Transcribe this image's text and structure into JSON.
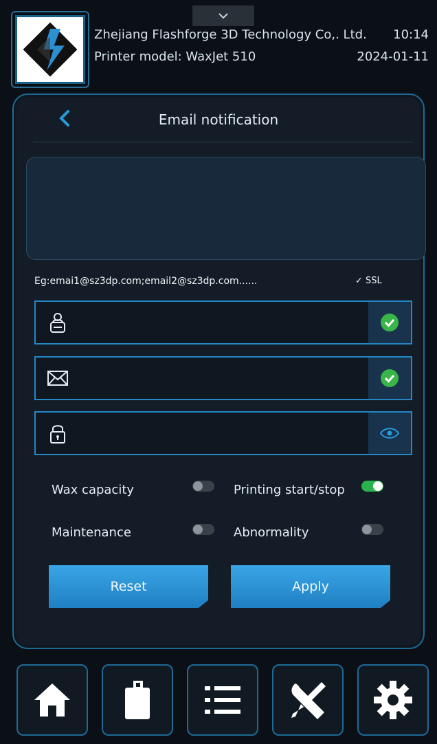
{
  "header": {
    "company": "Zhejiang Flashforge 3D Technology Co,. Ltd.",
    "model": "Printer model: WaxJet 510",
    "time": "10:14",
    "date": "2024-01-11"
  },
  "panel": {
    "title": "Email notification",
    "recipients_value": "",
    "hint": "Eg:emai1@sz3dp.com;email2@sz3dp.com......",
    "ssl": {
      "label": "SSL",
      "checked": true
    },
    "fields": [
      {
        "name": "sender",
        "value": "",
        "status": "valid"
      },
      {
        "name": "email",
        "value": "",
        "status": "valid"
      },
      {
        "name": "password",
        "value": "",
        "status": "reveal"
      }
    ],
    "options": [
      {
        "label": "Wax capacity",
        "on": false
      },
      {
        "label": "Printing start/stop",
        "on": true
      },
      {
        "label": "Maintenance",
        "on": false
      },
      {
        "label": "Abnormality",
        "on": false
      }
    ],
    "reset_label": "Reset",
    "apply_label": "Apply"
  },
  "nav": {
    "items": [
      {
        "icon": "home-icon"
      },
      {
        "icon": "material-bottle-icon"
      },
      {
        "icon": "list-icon"
      },
      {
        "icon": "tools-icon"
      },
      {
        "icon": "settings-gear-icon"
      }
    ]
  },
  "colors": {
    "accent": "#1e6a95",
    "button": "#2e94d6",
    "toggle_on": "#2bb24c",
    "check": "#3ab549",
    "background": "#0a1016"
  }
}
